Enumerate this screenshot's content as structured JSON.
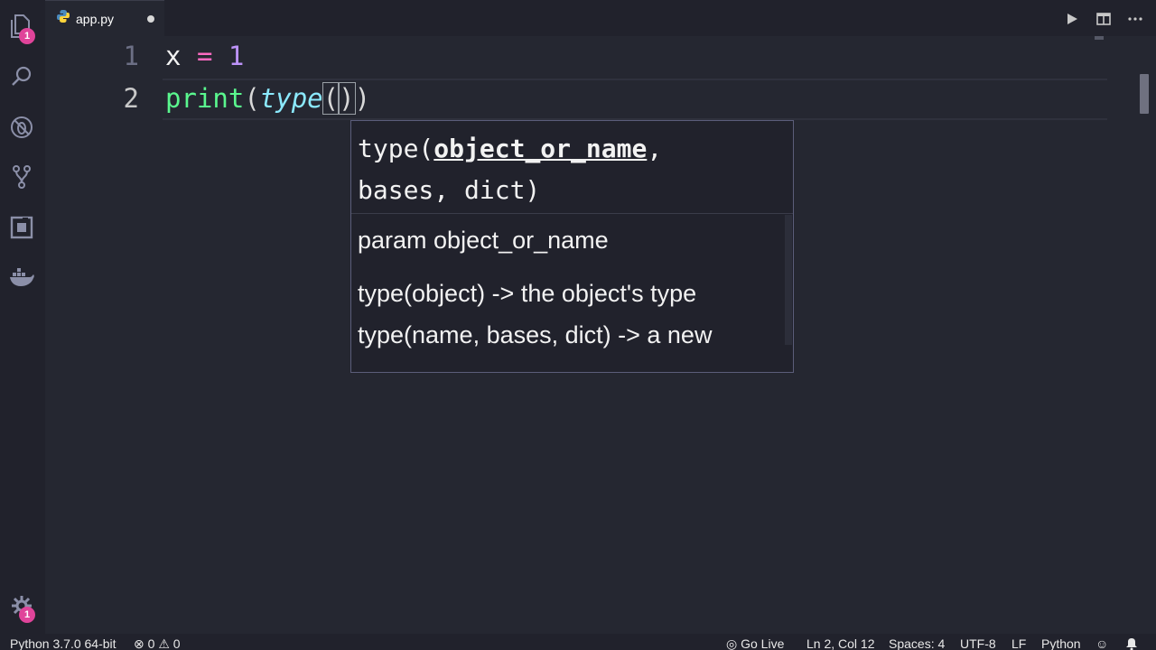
{
  "activity_bar": {
    "explorer_badge": "1",
    "settings_badge": "1"
  },
  "tabs": [
    {
      "title": "app.py",
      "modified": true
    }
  ],
  "editor": {
    "line_numbers": [
      "1",
      "2"
    ],
    "line1": {
      "var": "x",
      "op": "=",
      "num": "1"
    },
    "line2": {
      "fn": "print",
      "open1": "(",
      "type": "type",
      "open2": "(",
      "close2": ")",
      "close1": ")"
    }
  },
  "signature_help": {
    "sig_prefix": "type(",
    "sig_active_param": "object_or_name",
    "sig_comma": ",",
    "sig_rest": "bases, dict)",
    "param_doc": "param object_or_name",
    "doc_lines": [
      "type(object) -> the object's type",
      "type(name, bases, dict) -> a new"
    ]
  },
  "status_bar": {
    "interpreter": "Python 3.7.0 64-bit",
    "errors": "0",
    "warnings": "0",
    "go_live": "Go Live",
    "position": "Ln 2, Col 12",
    "spaces": "Spaces: 4",
    "encoding": "UTF-8",
    "eol": "LF",
    "language": "Python"
  },
  "colors": {
    "background": "#252731",
    "keyword_pink": "#ff6ac1",
    "function_green": "#5af78e",
    "type_cyan": "#8be9fd",
    "number_purple": "#bd93f9",
    "badge": "#e0449a"
  }
}
